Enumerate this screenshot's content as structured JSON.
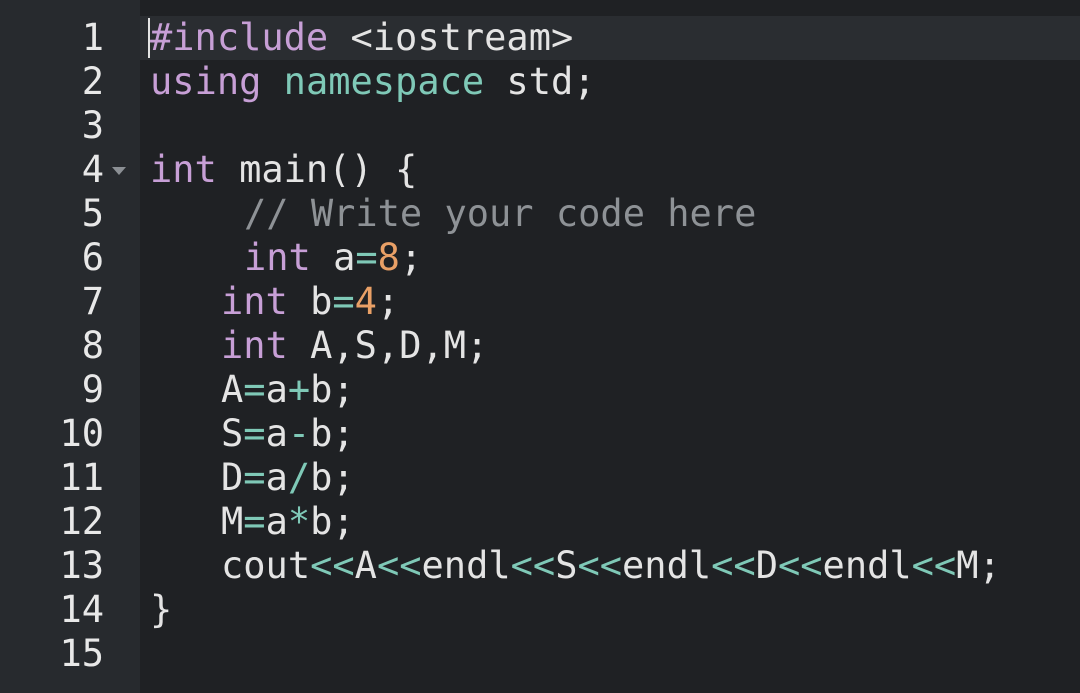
{
  "editor": {
    "line_numbers": [
      "1",
      "2",
      "3",
      "4",
      "5",
      "6",
      "7",
      "8",
      "9",
      "10",
      "11",
      "12",
      "13",
      "14",
      "15"
    ],
    "lines": {
      "l1": {
        "a": "#include",
        "b": " <iostream>"
      },
      "l2": {
        "a": "using",
        "b": " ",
        "c": "namespace",
        "d": " std;"
      },
      "l4": {
        "a": "int",
        "b": " main() {"
      },
      "l5": {
        "a": "// Write your code here"
      },
      "l6": {
        "a": "int",
        "b": " a",
        "c": "=",
        "d": "8",
        "e": ";"
      },
      "l7": {
        "a": "int",
        "b": " b",
        "c": "=",
        "d": "4",
        "e": ";"
      },
      "l8": {
        "a": "int",
        "b": " A,S,D,M;"
      },
      "l9": {
        "a": "A",
        "b": "=",
        "c": "a",
        "d": "+",
        "e": "b;"
      },
      "l10": {
        "a": "S",
        "b": "=",
        "c": "a",
        "d": "-",
        "e": "b;"
      },
      "l11": {
        "a": "D",
        "b": "=",
        "c": "a",
        "d": "/",
        "e": "b;"
      },
      "l12": {
        "a": "M",
        "b": "=",
        "c": "a",
        "d": "*",
        "e": "b;"
      },
      "l13": {
        "a": "cout",
        "b": "<<",
        "c": "A",
        "d": "<<",
        "e": "endl",
        "f": "<<",
        "g": "S",
        "h": "<<",
        "i": "endl",
        "j": "<<",
        "k": "D",
        "l": "<<",
        "m": "endl",
        "n": "<<",
        "o": "M;"
      },
      "l14": {
        "a": "}"
      }
    },
    "colors": {
      "background": "#1f2124",
      "gutter": "#272a2e",
      "keyword": "#c79fd6",
      "namespace": "#7fc9b7",
      "comment": "#8e9296",
      "number": "#e9a066",
      "text": "#e4e4e4"
    },
    "icons": {
      "fold": "chevron-down-icon"
    }
  }
}
